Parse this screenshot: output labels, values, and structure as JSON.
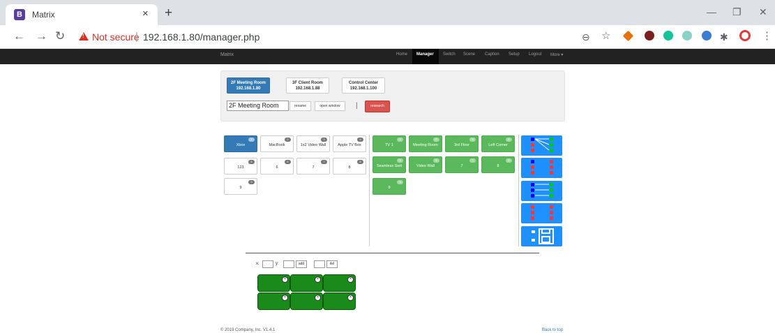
{
  "browser": {
    "tab_title": "Matrix",
    "tab_close": "×",
    "new_tab": "+",
    "favicon_letter": "B",
    "not_secure": "Not secure",
    "url": "192.168.1.80/manager.php",
    "window_controls": [
      "—",
      "❐",
      "✕"
    ]
  },
  "navbar": {
    "brand": "Matrix",
    "items": [
      "Home",
      "Manager",
      "Switch",
      "Scene",
      "Caption",
      "Setup",
      "Logout",
      "More ▾"
    ],
    "active": "Manager"
  },
  "rooms": {
    "buttons": [
      {
        "name": "2F Meeting Room",
        "ip": "192.168.1.80",
        "active": true
      },
      {
        "name": "3F Client Room",
        "ip": "192.168.1.88",
        "active": false
      },
      {
        "name": "Control Center",
        "ip": "192.168.1.100",
        "active": false
      }
    ],
    "name_value": "2F Meeting Room",
    "rename_label": "rename",
    "open_window_label": "open window",
    "separator": "|",
    "research_label": "research"
  },
  "inputs": [
    {
      "label": "Xbox",
      "num": "1",
      "active": true
    },
    {
      "label": "MacBook",
      "num": "2",
      "active": false
    },
    {
      "label": "1x2 Video Wall",
      "num": "3",
      "active": false
    },
    {
      "label": "Apple TV Box",
      "num": "4",
      "active": false
    },
    {
      "label": "123",
      "num": "5",
      "active": false
    },
    {
      "label": "6",
      "num": "6",
      "active": false
    },
    {
      "label": "7",
      "num": "7",
      "active": false
    },
    {
      "label": "8",
      "num": "8",
      "active": false
    },
    {
      "label": "9",
      "num": "9",
      "active": false
    }
  ],
  "outputs": [
    {
      "label": "TV 1",
      "num": "1"
    },
    {
      "label": "Meeting Room",
      "num": "2"
    },
    {
      "label": "3rd Floor",
      "num": "3"
    },
    {
      "label": "Left Corner",
      "num": "4"
    },
    {
      "label": "Seamless Swit",
      "num": "5"
    },
    {
      "label": "Video Wall",
      "num": "6"
    },
    {
      "label": "7",
      "num": "7"
    },
    {
      "label": "8",
      "num": "8"
    },
    {
      "label": "9",
      "num": "9"
    }
  ],
  "modes": [
    "one-to-many-mode-icon",
    "cross-mode-icon",
    "one-to-one-mode-icon",
    "parallel-mode-icon",
    "save-icon"
  ],
  "wall": {
    "x_label": "x:",
    "y_label": "y:",
    "add_label": "add",
    "del_label": "del",
    "cells": [
      "×",
      "×",
      "×",
      "×",
      "×",
      "×"
    ]
  },
  "footer": {
    "copyright": "© 2019 Company, Inc. V1.4.1",
    "back_to_top": "Back to top"
  },
  "colors": {
    "primary": "#337ab7",
    "success": "#5cb85c",
    "danger": "#d9534f",
    "mode_blue": "#1e90ff",
    "wall_green": "#1a8a1a",
    "navbar": "#222222"
  }
}
